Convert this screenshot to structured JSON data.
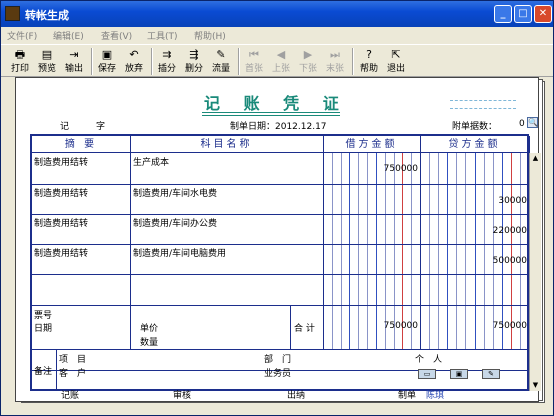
{
  "window": {
    "title": "转帐生成"
  },
  "menu": [
    "文件(F)",
    "编辑(E)",
    "查看(V)",
    "工具(T)",
    "帮助(H)"
  ],
  "toolbar": [
    {
      "label": "打印",
      "icon": "printer-icon",
      "enabled": true
    },
    {
      "label": "预览",
      "icon": "preview-icon",
      "enabled": true
    },
    {
      "label": "输出",
      "icon": "export-icon",
      "enabled": true
    },
    {
      "label": "保存",
      "icon": "save-icon",
      "enabled": true
    },
    {
      "label": "放弃",
      "icon": "undo-icon",
      "enabled": true
    },
    {
      "label": "插分",
      "icon": "insert-row-icon",
      "enabled": true
    },
    {
      "label": "删分",
      "icon": "delete-row-icon",
      "enabled": true
    },
    {
      "label": "流量",
      "icon": "cashflow-icon",
      "enabled": true
    },
    {
      "label": "首张",
      "icon": "first-icon",
      "enabled": false
    },
    {
      "label": "上张",
      "icon": "prev-icon",
      "enabled": false
    },
    {
      "label": "下张",
      "icon": "next-icon",
      "enabled": false
    },
    {
      "label": "末张",
      "icon": "last-icon",
      "enabled": false
    },
    {
      "label": "帮助",
      "icon": "help-icon",
      "enabled": true
    },
    {
      "label": "退出",
      "icon": "exit-icon",
      "enabled": true
    }
  ],
  "voucher": {
    "title": "记 账 凭 证",
    "type_label": "记",
    "no_label": "字",
    "date_label": "制单日期：2012.12.17",
    "attach_label": "附单据数：",
    "attach_value": "0",
    "columns": {
      "summary": "摘 要",
      "account": "科目名称",
      "debit": "借方金额",
      "credit": "贷方金额"
    },
    "rows": [
      {
        "summary": "制造费用结转",
        "account": "生产成本",
        "debit": "750000",
        "credit": ""
      },
      {
        "summary": "制造费用结转",
        "account": "制造费用/车间水电费",
        "debit": "",
        "credit": "30000"
      },
      {
        "summary": "制造费用结转",
        "account": "制造费用/车间办公费",
        "debit": "",
        "credit": "220000"
      },
      {
        "summary": "制造费用结转",
        "account": "制造费用/车间电脑费用",
        "debit": "",
        "credit": "500000"
      }
    ],
    "bottom": {
      "ticket": "票号",
      "date": "日期",
      "price": "单价",
      "qty": "数量",
      "total_label": "合 计",
      "total_debit": "750000",
      "total_credit": "750000"
    },
    "remark": {
      "label": "备注",
      "project": "项　目",
      "dept": "部　门",
      "person": "个　人",
      "customer": "客　户",
      "salesman": "业务员"
    }
  },
  "footer": {
    "bookkeep": "记账",
    "audit": "审核",
    "cashier": "出纳",
    "maker": "制单",
    "maker_name": "陈琪"
  }
}
